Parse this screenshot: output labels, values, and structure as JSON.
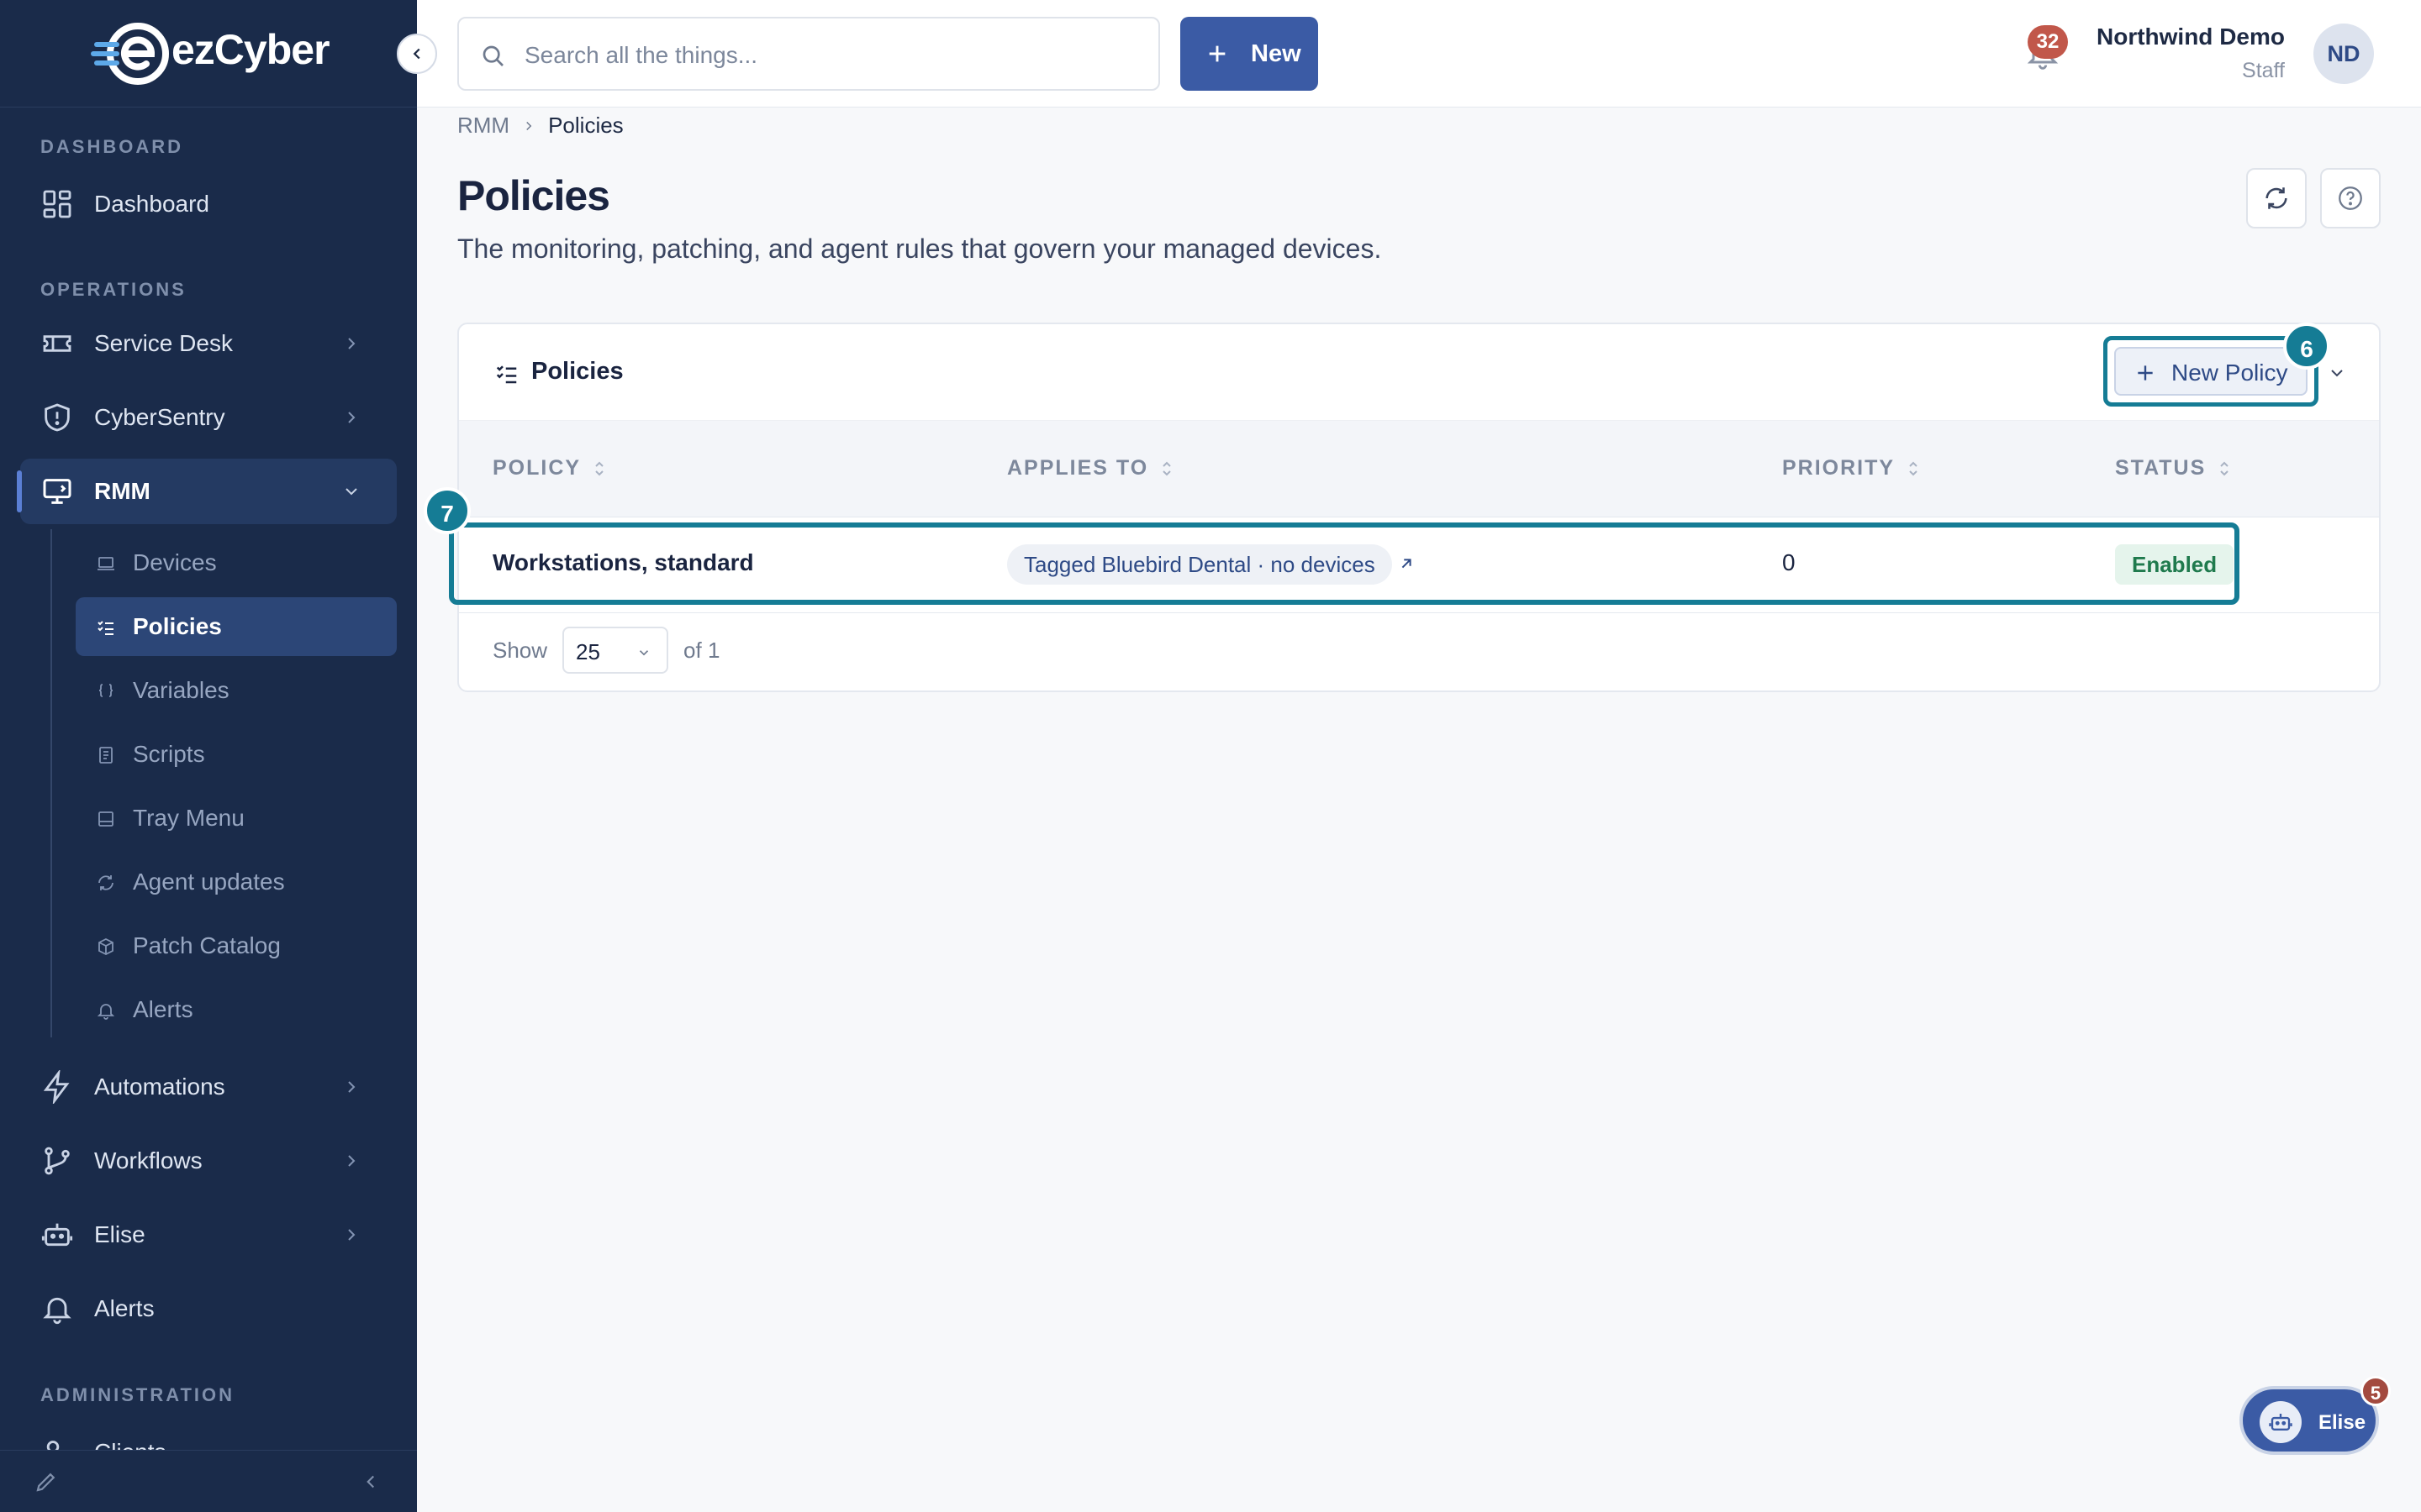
{
  "brand": {
    "name": "ezCyber"
  },
  "sidebar": {
    "sections": {
      "dashboard": "DASHBOARD",
      "operations": "OPERATIONS",
      "administration": "ADMINISTRATION"
    },
    "items": {
      "dashboard": "Dashboard",
      "service_desk": "Service Desk",
      "cybersentry": "CyberSentry",
      "rmm": "RMM",
      "automations": "Automations",
      "workflows": "Workflows",
      "elise": "Elise",
      "alerts": "Alerts",
      "clients": "Clients"
    },
    "rmm_sub": {
      "devices": "Devices",
      "policies": "Policies",
      "variables": "Variables",
      "scripts": "Scripts",
      "tray_menu": "Tray Menu",
      "agent_updates": "Agent updates",
      "patch_catalog": "Patch Catalog",
      "alerts": "Alerts"
    },
    "active_item": "RMM",
    "active_sub": "Policies"
  },
  "topbar": {
    "search_placeholder": "Search all the things...",
    "new_label": "New",
    "notification_count": "32",
    "user_name": "Northwind Demo",
    "user_role": "Staff",
    "avatar_initials": "ND"
  },
  "breadcrumb": {
    "parent": "RMM",
    "current": "Policies"
  },
  "page": {
    "title": "Policies",
    "subtitle": "The monitoring, patching, and agent rules that govern your managed devices."
  },
  "card": {
    "title": "Policies",
    "new_policy_label": "New Policy",
    "columns": {
      "policy": "POLICY",
      "applies_to": "APPLIES TO",
      "priority": "PRIORITY",
      "status": "STATUS"
    },
    "rows": [
      {
        "policy": "Workstations, standard",
        "applies_to": "Tagged Bluebird Dental · no devices",
        "priority": "0",
        "status": "Enabled"
      }
    ],
    "pager": {
      "show_label": "Show",
      "page_size": "25",
      "of_label": "of 1"
    }
  },
  "markers": {
    "new_policy": "6",
    "row": "7"
  },
  "elise_fab": {
    "label": "Elise",
    "badge": "5"
  },
  "colors": {
    "sidebar_bg": "#1a2b4a",
    "primary": "#3b5ba5",
    "highlight": "#157c95",
    "status_green": "#1f7a4d",
    "badge_red": "#c1574a"
  }
}
